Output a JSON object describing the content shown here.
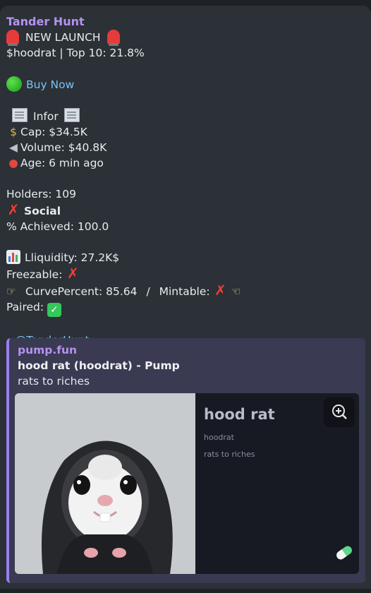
{
  "message": {
    "sender": "Tander Hunt",
    "headline": "NEW LAUNCH",
    "ticker_line": "$hoodrat | Top 10: 21.8%",
    "buy_link": "Buy Now",
    "info_label": "Infor",
    "cap": "Cap: $34.5K",
    "volume": "Volume: $40.8K",
    "age": "Age: 6 min ago",
    "holders": "Holders: 109",
    "social": "Social",
    "achieved": "% Achieved: 100.0",
    "liquidity": "Lliquidity: 27.2K$",
    "freezable": "Freezable:",
    "curve": "CurvePercent: 85.64",
    "separator": "/",
    "mintable": "Mintable:",
    "paired": "Paired:",
    "footer_prefix": "_ ",
    "footer_handle": "@TanderHunt",
    "footer_suffix": " _"
  },
  "preview": {
    "site": "pump.fun",
    "title": "hood rat (hoodrat) - Pump",
    "description": "rats to riches",
    "card": {
      "name": "hood rat",
      "ticker": "hoodrat",
      "desc": "rats to riches"
    }
  },
  "icons": {
    "siren": "police-light-icon",
    "green_dot": "green-circle-icon",
    "newspaper": "newspaper-icon",
    "money_bag": "money-bag-icon",
    "speaker": "speaker-icon",
    "pushpin": "pushpin-icon",
    "chart": "bar-chart-icon",
    "cross": "cross-mark-icon",
    "check": "check-mark-icon",
    "hand": "pointing-hand-icon",
    "zoom": "zoom-in-icon",
    "pill": "pill-icon"
  },
  "colors": {
    "background": "#1e2227",
    "bubble": "#2b3136",
    "sender": "#b592f0",
    "link": "#79c2f4",
    "preview_bg": "#3a3a52",
    "preview_bar": "#9a7ef0"
  }
}
